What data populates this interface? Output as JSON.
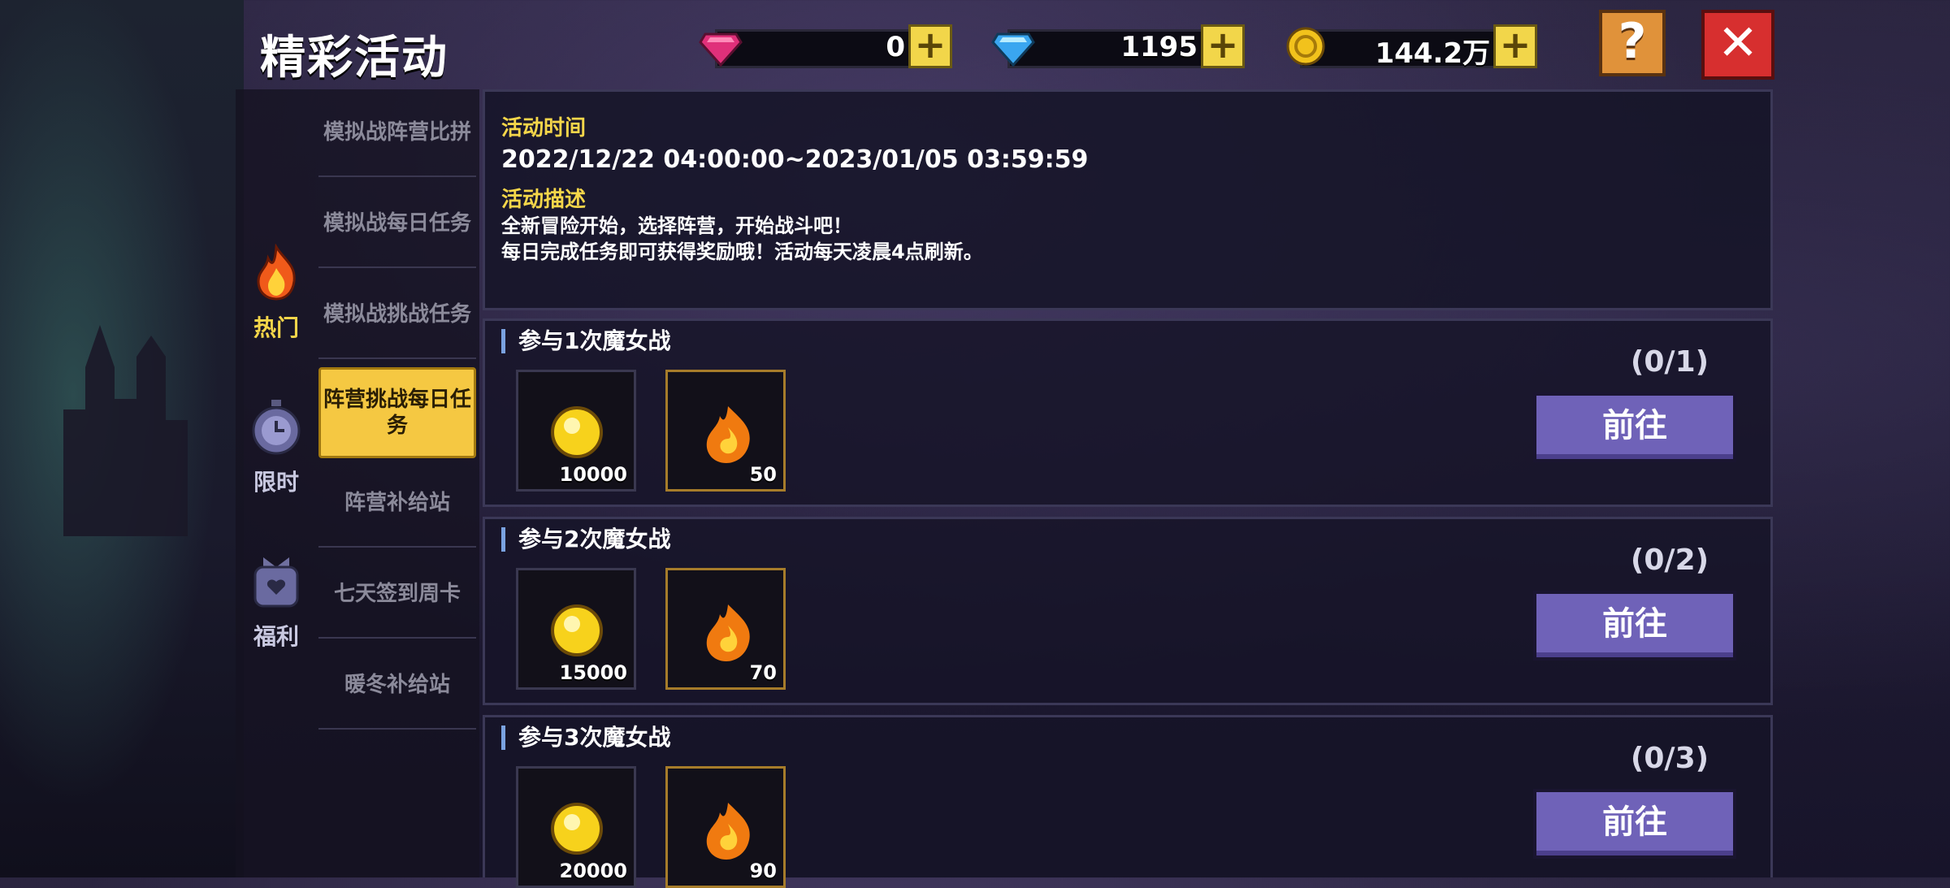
{
  "title": "精彩活动",
  "currencies": {
    "pink_gem": "0",
    "blue_gem": "1195",
    "gold": "144.2万"
  },
  "help_label": "?",
  "close_label": "✕",
  "categories": [
    {
      "label": "热门",
      "icon": "flame-icon",
      "color": "#f5d64a"
    },
    {
      "label": "限时",
      "icon": "clock-icon",
      "color": "#c8c8e0"
    },
    {
      "label": "福利",
      "icon": "gift-bag-icon",
      "color": "#c8c8e0"
    }
  ],
  "subtabs": [
    "模拟战阵营比拼",
    "模拟战每日任务",
    "模拟战挑战任务",
    "阵营挑战每日任务",
    "阵营补给站",
    "七天签到周卡",
    "暖冬补给站"
  ],
  "info": {
    "time_heading": "活动时间",
    "time_value": "2022/12/22 04:00:00~2023/01/05 03:59:59",
    "desc_heading": "活动描述",
    "desc_line1": "全新冒险开始，选择阵营，开始战斗吧！",
    "desc_line2": "每日完成任务即可获得奖励哦！活动每天凌晨4点刷新。"
  },
  "tasks": [
    {
      "name": "参与1次魔女战",
      "progress": "(0/1)",
      "button": "前往",
      "coin": "10000",
      "flame": "50"
    },
    {
      "name": "参与2次魔女战",
      "progress": "(0/2)",
      "button": "前往",
      "coin": "15000",
      "flame": "70"
    },
    {
      "name": "参与3次魔女战",
      "progress": "(0/3)",
      "button": "前往",
      "coin": "20000",
      "flame": "90"
    }
  ]
}
